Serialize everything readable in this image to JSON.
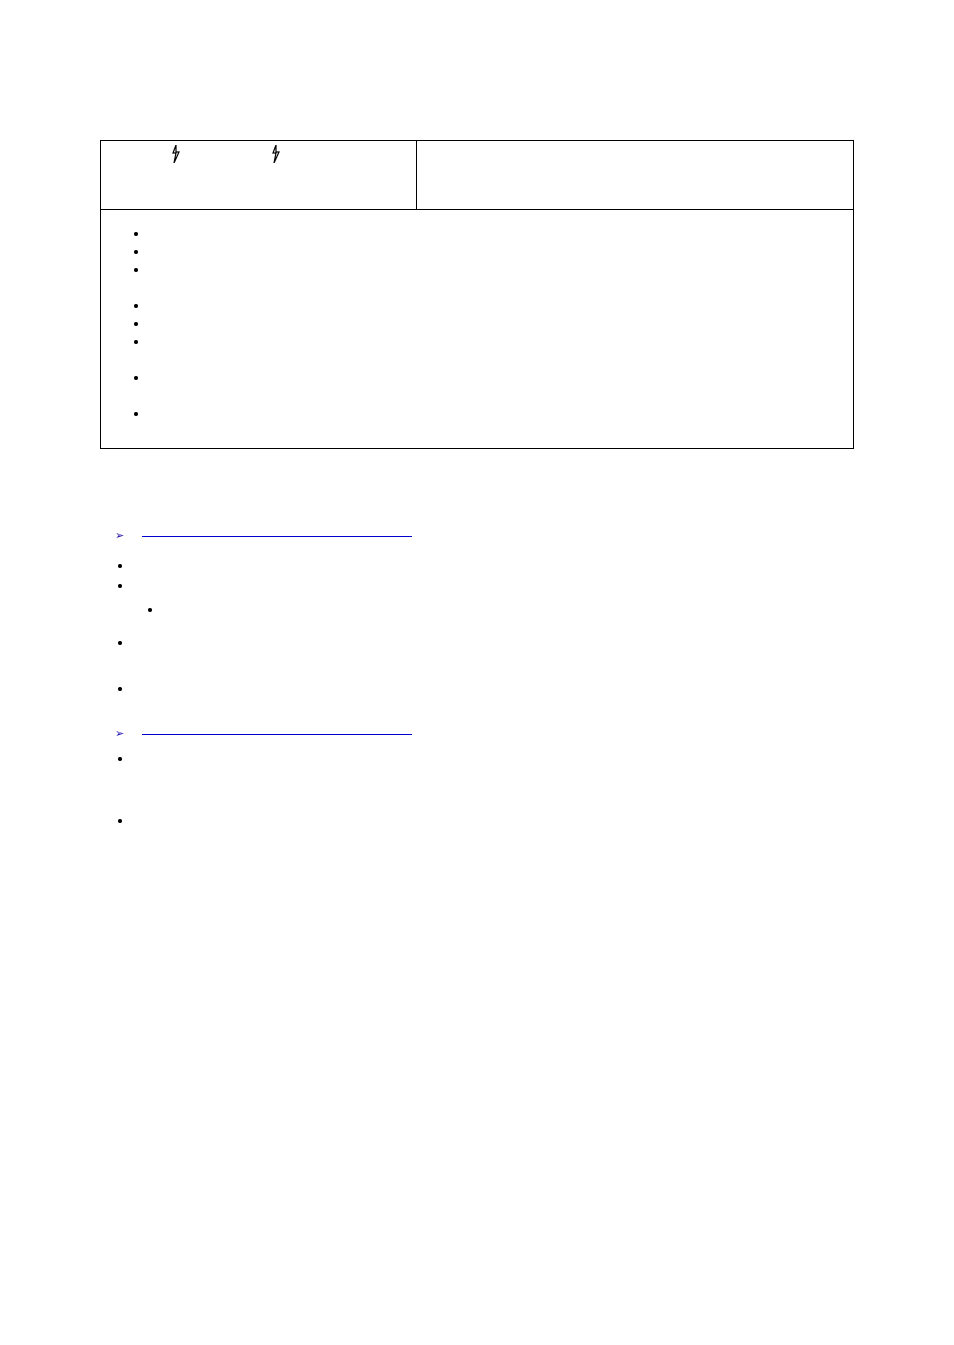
{
  "table": {
    "header_left": "",
    "header_right": "",
    "bullets_left": [
      "",
      "",
      "",
      "",
      "",
      "",
      "",
      ""
    ]
  },
  "section1": {
    "link_text": "",
    "items": [
      "",
      "",
      "",
      "",
      ""
    ]
  },
  "section2": {
    "link_text": "",
    "items": [
      "",
      ""
    ]
  }
}
